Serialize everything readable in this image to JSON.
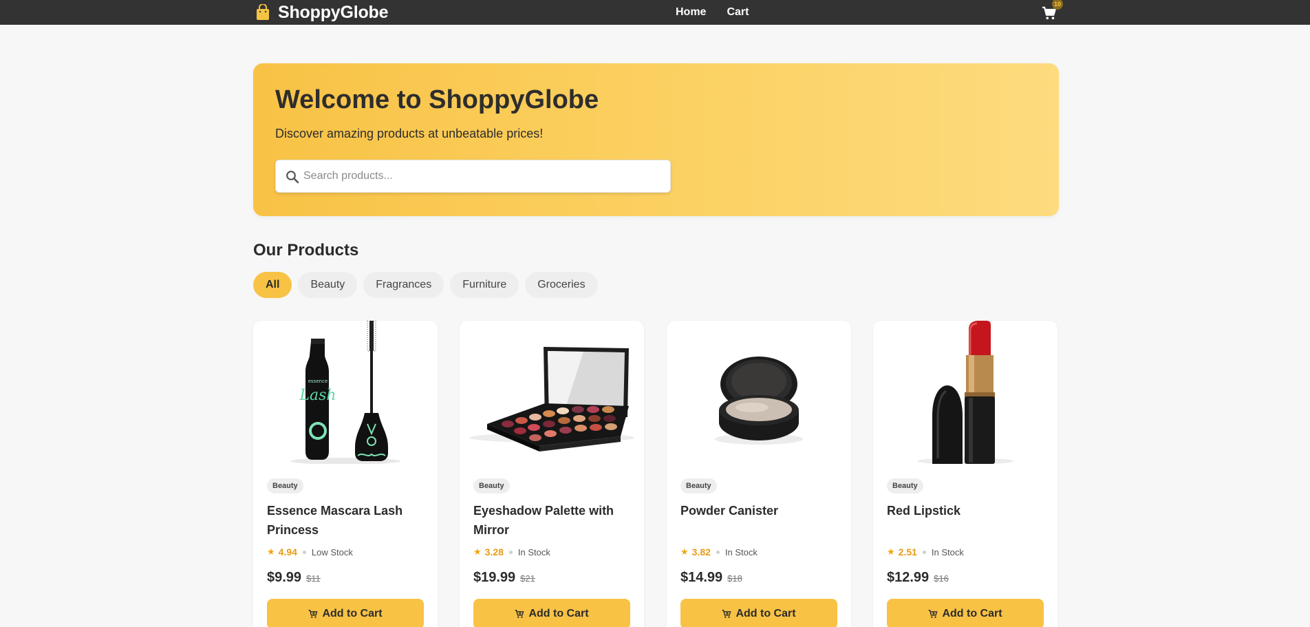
{
  "navbar": {
    "brand": "ShoppyGlobe",
    "brand_icon": "shopping-bag-icon",
    "links": [
      "Home",
      "Cart"
    ],
    "cart_icon": "cart-icon",
    "cart_count": "10"
  },
  "hero": {
    "title": "Welcome to ShoppyGlobe",
    "subtitle": "Discover amazing products at unbeatable prices!",
    "search_placeholder": "Search products..."
  },
  "section": {
    "title": "Our Products",
    "filters": [
      "All",
      "Beauty",
      "Fragrances",
      "Furniture",
      "Groceries"
    ],
    "active_filter": "All"
  },
  "products": [
    {
      "category": "Beauty",
      "title": "Essence Mascara Lash Princess",
      "rating": "4.94",
      "stock": "Low Stock",
      "price": "$9.99",
      "old_price": "$11",
      "button": "Add to Cart",
      "image": "mascara-image"
    },
    {
      "category": "Beauty",
      "title": "Eyeshadow Palette with Mirror",
      "rating": "3.28",
      "stock": "In Stock",
      "price": "$19.99",
      "old_price": "$21",
      "button": "Add to Cart",
      "image": "eyeshadow-palette-image"
    },
    {
      "category": "Beauty",
      "title": "Powder Canister",
      "rating": "3.82",
      "stock": "In Stock",
      "price": "$14.99",
      "old_price": "$18",
      "button": "Add to Cart",
      "image": "powder-canister-image"
    },
    {
      "category": "Beauty",
      "title": "Red Lipstick",
      "rating": "2.51",
      "stock": "In Stock",
      "price": "$12.99",
      "old_price": "$16",
      "button": "Add to Cart",
      "image": "red-lipstick-image"
    }
  ],
  "colors": {
    "navbar": "#333333",
    "accent": "#f8c245",
    "rating": "#e69b12",
    "page_background": "#f7f7f7"
  }
}
